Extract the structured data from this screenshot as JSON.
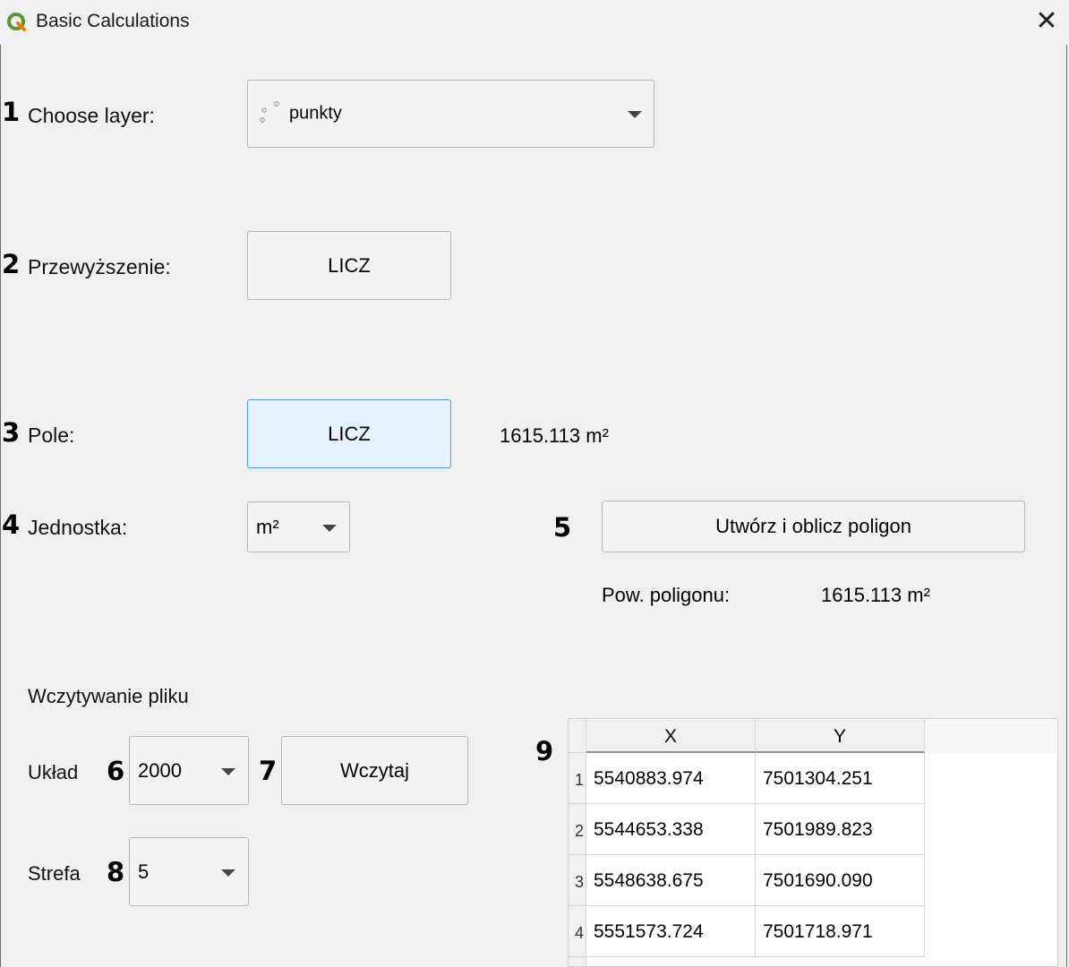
{
  "window": {
    "title": "Basic Calculations",
    "close_glyph": "✕",
    "icon": "qgis-logo-icon"
  },
  "choose_layer": {
    "number": "1",
    "label": "Choose layer:",
    "value": "punkty",
    "icon": "point-layer-icon"
  },
  "elevation": {
    "number": "2",
    "label": "Przewyższenie:",
    "button_label": "LICZ"
  },
  "area": {
    "number": "3",
    "label": "Pole:",
    "button_label": "LICZ",
    "result": "1615.113 m²"
  },
  "unit": {
    "number": "4",
    "label": "Jednostka:",
    "value": "m²"
  },
  "polygon": {
    "number": "5",
    "button_label": "Utwórz i oblicz poligon",
    "area_label": "Pow. poligonu:",
    "area_value": "1615.113 m²"
  },
  "file_loading": {
    "heading": "Wczytywanie pliku",
    "system_label": "Układ",
    "system_number": "6",
    "system_value": "2000",
    "load_number": "7",
    "load_button": "Wczytaj",
    "zone_label": "Strefa",
    "zone_number": "8",
    "zone_value": "5"
  },
  "table": {
    "number": "9",
    "columns": [
      "X",
      "Y"
    ],
    "rows": [
      {
        "index": "1",
        "x": "5540883.974",
        "y": "7501304.251"
      },
      {
        "index": "2",
        "x": "5544653.338",
        "y": "7501989.823"
      },
      {
        "index": "3",
        "x": "5548638.675",
        "y": "7501690.090"
      },
      {
        "index": "4",
        "x": "5551573.724",
        "y": "7501718.971"
      }
    ]
  },
  "colors": {
    "focused_button_bg": "#e5f1fb",
    "focused_button_border": "#4a9be0",
    "qgis_green": "#589632",
    "qgis_yellow": "#ee7913"
  }
}
